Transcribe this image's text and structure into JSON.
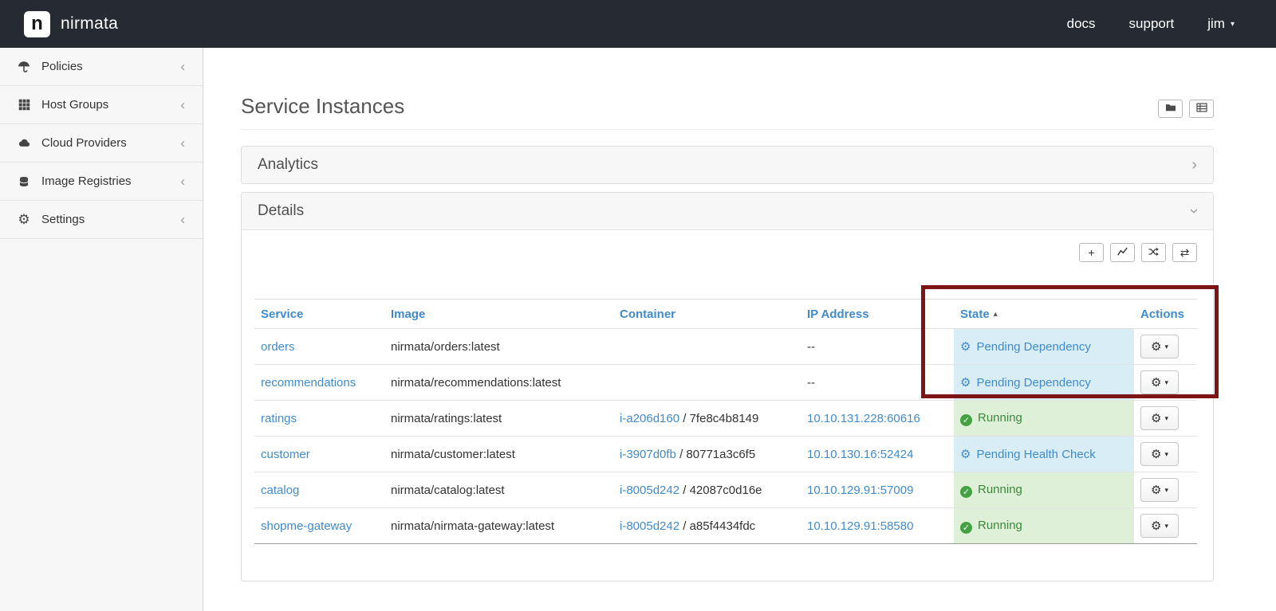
{
  "navbar": {
    "logo_letter": "n",
    "brand": "nirmata",
    "links": [
      {
        "label": "docs"
      },
      {
        "label": "support"
      }
    ],
    "user_label": "jim"
  },
  "icons": {
    "caret-down": "▾",
    "collapse-chevron": "‹",
    "expand-chevron": "›",
    "sort-asc": "▴",
    "plus": "+",
    "swap-arrows": "⇄",
    "gear": "⚙",
    "pending": "⚙",
    "running": "✓"
  },
  "colors": {
    "accent_blue": "#428bca",
    "pending_bg": "#d9edf7",
    "running_bg": "#dff0d8",
    "running_text": "#3c883c",
    "annotation_red": "#7d1416",
    "navbar_bg": "#252a33"
  },
  "sidebar": {
    "items": [
      {
        "label": "Policies"
      },
      {
        "label": "Host Groups"
      },
      {
        "label": "Cloud Providers"
      },
      {
        "label": "Image Registries"
      },
      {
        "label": "Settings"
      }
    ]
  },
  "main": {
    "title": "Service Instances",
    "analytics_panel": {
      "title": "Analytics",
      "state": "collapsed"
    },
    "details_panel": {
      "title": "Details",
      "state": "expanded"
    },
    "table": {
      "columns": [
        "Service",
        "Image",
        "Container",
        "IP Address",
        "State",
        "Actions"
      ],
      "sorted_by": "State",
      "sort_direction": "asc",
      "rows": [
        {
          "service": "orders",
          "image": "nirmata/orders:latest",
          "container_id": "",
          "container_sep": "",
          "container_hash": "",
          "ip": "--",
          "ip_class": "plain",
          "state": "Pending Dependency",
          "state_type": "pending"
        },
        {
          "service": "recommendations",
          "image": "nirmata/recommendations:latest",
          "container_id": "",
          "container_sep": "",
          "container_hash": "",
          "ip": "--",
          "ip_class": "plain",
          "state": "Pending Dependency",
          "state_type": "pending"
        },
        {
          "service": "ratings",
          "image": "nirmata/ratings:latest",
          "container_id": "i-a206d160",
          "container_sep": " / ",
          "container_hash": "7fe8c4b8149",
          "ip": "10.10.131.228:60616",
          "ip_class": "link",
          "state": "Running",
          "state_type": "running"
        },
        {
          "service": "customer",
          "image": "nirmata/customer:latest",
          "container_id": "i-3907d0fb",
          "container_sep": " / ",
          "container_hash": "80771a3c6f5",
          "ip": "10.10.130.16:52424",
          "ip_class": "link",
          "state": "Pending Health Check",
          "state_type": "pending"
        },
        {
          "service": "catalog",
          "image": "nirmata/catalog:latest",
          "container_id": "i-8005d242",
          "container_sep": " / ",
          "container_hash": "42087c0d16e",
          "ip": "10.10.129.91:57009",
          "ip_class": "link",
          "state": "Running",
          "state_type": "running"
        },
        {
          "service": "shopme-gateway",
          "image": "nirmata/nirmata-gateway:latest",
          "container_id": "i-8005d242",
          "container_sep": " / ",
          "container_hash": "a85f4434fdc",
          "ip": "10.10.129.91:58580",
          "ip_class": "link",
          "state": "Running",
          "state_type": "running"
        }
      ]
    }
  }
}
